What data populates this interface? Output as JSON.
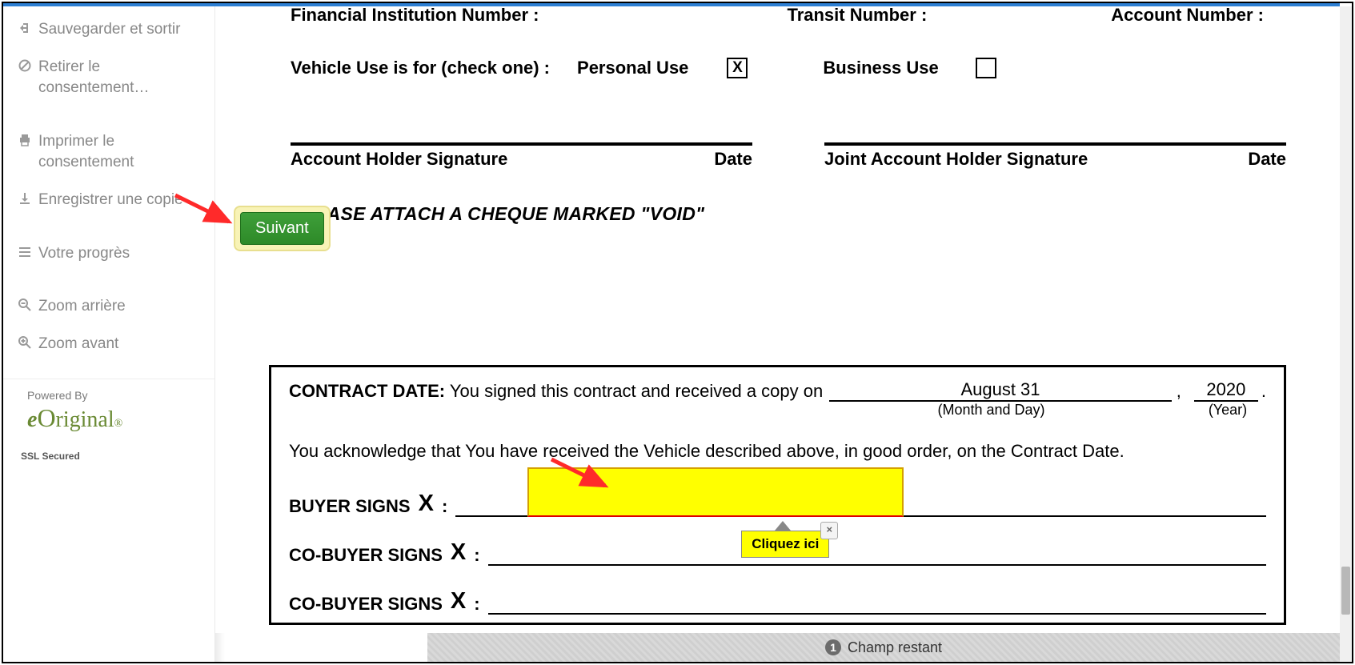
{
  "sidebar": {
    "save_exit": "Sauvegarder et sortir",
    "withdraw": "Retirer le consentement…",
    "print": "Imprimer le consentement",
    "save_copy": "Enregistrer une copie",
    "progress": "Votre progrès",
    "zoom_out": "Zoom arrière",
    "zoom_in": "Zoom avant",
    "powered_by": "Powered By",
    "brand": "eOriginal",
    "ssl": "SSL Secured"
  },
  "suivant": {
    "label": "Suivant"
  },
  "doc": {
    "fin_number": "Financial Institution Number :",
    "transit": "Transit Number :",
    "account": "Account Number :",
    "vehicle_use_lbl": "Vehicle Use is for (check one) :",
    "personal": "Personal Use",
    "personal_checked": "X",
    "business": "Business Use",
    "sig1_lbl": "Account Holder Signature",
    "sig_date": "Date",
    "sig2_lbl": "Joint Account Holder Signature",
    "attach_void": "PLEASE ATTACH A CHEQUE MARKED \"VOID\"",
    "contract_date_lbl": "CONTRACT DATE:",
    "contract_date_text": "You signed this contract and received a copy on",
    "md": "August 31",
    "md_sub": "(Month and Day)",
    "year": "2020",
    "year_sub": "(Year)",
    "ack": "You acknowledge that You have received the Vehicle described above, in good order, on the Contract Date.",
    "buyer_signs": "BUYER SIGNS",
    "cobuyer_signs": "CO-BUYER SIGNS",
    "bigx": "X",
    "colon": ":"
  },
  "tooltip": {
    "text": "Cliquez ici",
    "close": "×"
  },
  "footer": {
    "count": "1",
    "text": "Champ restant"
  }
}
